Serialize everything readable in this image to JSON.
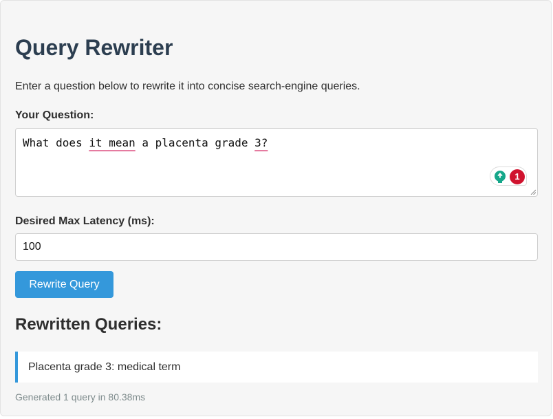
{
  "page": {
    "title": "Query Rewriter",
    "intro": "Enter a question below to rewrite it into concise search-engine queries."
  },
  "question": {
    "label": "Your Question:",
    "text_parts": [
      "What does ",
      "it mean",
      " a placenta grade ",
      "3?"
    ],
    "spellcheck_flagged": [
      "it mean",
      "3?"
    ],
    "grammar_badge": {
      "count": "1",
      "icon": "lightbulb-icon",
      "color": "#15a78a",
      "count_color": "#d0122e"
    }
  },
  "latency": {
    "label": "Desired Max Latency (ms):",
    "value": "100"
  },
  "rewrite_button": {
    "label": "Rewrite Query",
    "color": "#3498db"
  },
  "results": {
    "heading": "Rewritten Queries:",
    "queries": [
      "Placenta grade 3: medical term"
    ],
    "meta": "Generated 1 query in 80.38ms"
  },
  "colors": {
    "title": "#2c3e50",
    "accent": "#3498db",
    "muted": "#7f8c8d"
  }
}
